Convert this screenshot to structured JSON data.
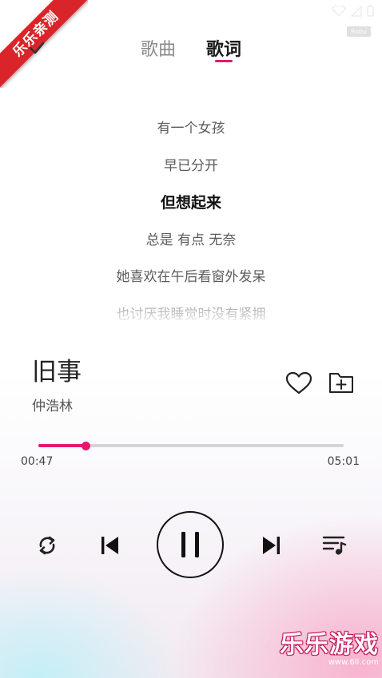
{
  "badge": {
    "ribbon_text": "乐乐亲测",
    "tag_text": "9obu"
  },
  "tabs": [
    {
      "label": "歌曲",
      "active": false
    },
    {
      "label": "歌词",
      "active": true
    }
  ],
  "lyrics": [
    {
      "text": "有一个女孩",
      "current": false
    },
    {
      "text": "早已分开",
      "current": false
    },
    {
      "text": "但想起来",
      "current": true
    },
    {
      "text": "总是 有点 无奈",
      "current": false
    },
    {
      "text": "她喜欢在午后看窗外发呆",
      "current": false
    },
    {
      "text": "也讨厌我睡觉时没有紧拥",
      "current": false
    }
  ],
  "song": {
    "title": "旧事",
    "artist": "仲浩林"
  },
  "player": {
    "current_time": "00:47",
    "total_time": "05:01",
    "progress_fraction": 0.156,
    "accent_color": "#e6186e",
    "controls": [
      "repeat-icon",
      "previous-icon",
      "pause-icon",
      "next-icon",
      "playlist-icon"
    ]
  },
  "watermark": {
    "brand": "乐乐游戏",
    "url": "www.6ll.com"
  }
}
